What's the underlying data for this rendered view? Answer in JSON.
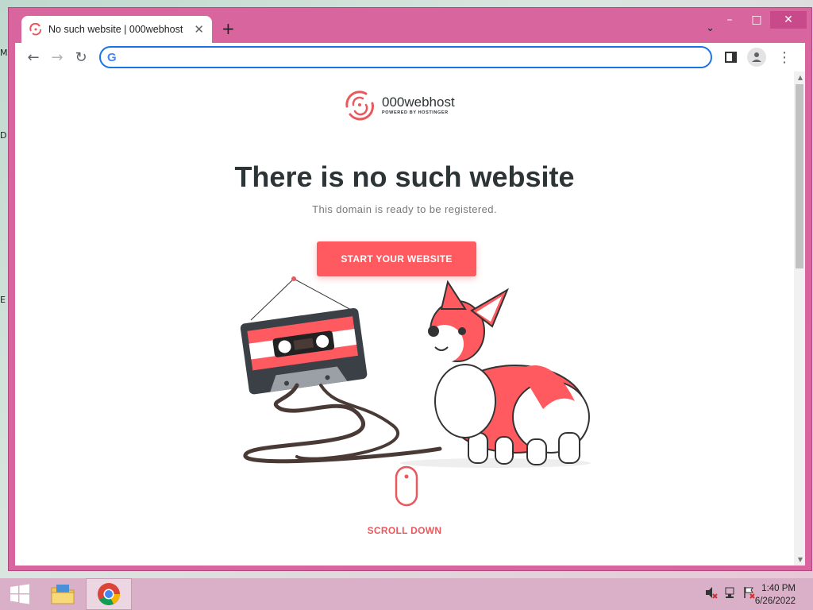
{
  "desktop": {
    "edge_letters": [
      "M",
      "D",
      "E"
    ]
  },
  "window": {
    "controls": {
      "minimize": "–",
      "maximize": "□",
      "close": "✕"
    }
  },
  "tab": {
    "title": "No such website | 000webhost",
    "close_glyph": "✕",
    "new_tab_glyph": "+",
    "search_tabs_glyph": "⌄"
  },
  "toolbar": {
    "back_glyph": "←",
    "forward_glyph": "→",
    "reload_glyph": "↻",
    "omnibox_value": "",
    "omnibox_icon": "G",
    "menu_glyph": "⋮"
  },
  "page": {
    "logo_name": "000webhost",
    "logo_powered": "POWERED BY HOSTINGER",
    "headline": "There is no such website",
    "subline": "This domain is ready to be registered.",
    "cta_label": "START YOUR WEBSITE",
    "scroll_label": "SCROLL DOWN"
  },
  "colors": {
    "accent": "#ff5a5f",
    "heading": "#2d3436",
    "window_frame": "#d9659f",
    "omnibox_focus": "#1a73e8"
  },
  "taskbar": {
    "items": [
      "start-button",
      "file-explorer-icon",
      "chrome-icon"
    ],
    "clock_time": "1:40 PM",
    "clock_date": "6/26/2022"
  }
}
